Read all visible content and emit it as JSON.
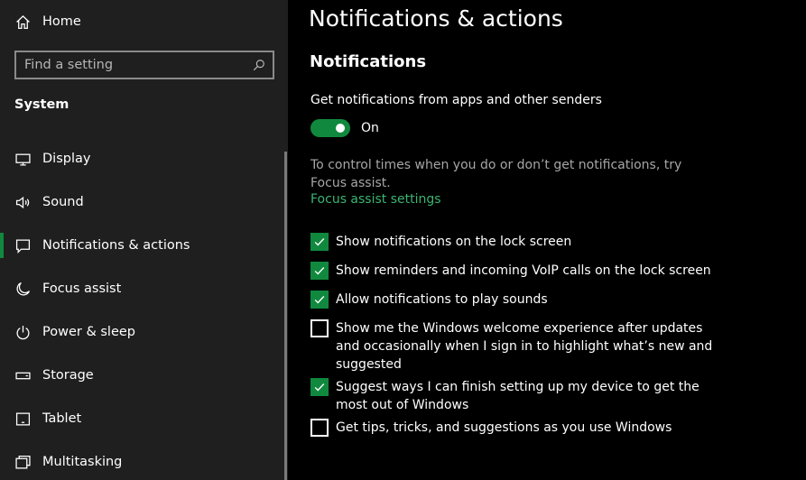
{
  "colors": {
    "accent": "#10893e",
    "link": "#3cb371",
    "sidebar_bg": "#1f1f1f",
    "main_bg": "#000000"
  },
  "sidebar": {
    "home": {
      "label": "Home",
      "icon": "home-icon"
    },
    "search": {
      "placeholder": "Find a setting",
      "value": "",
      "icon": "search-icon"
    },
    "section": "System",
    "items": [
      {
        "label": "Display",
        "icon": "display-icon",
        "active": false
      },
      {
        "label": "Sound",
        "icon": "speaker-icon",
        "active": false
      },
      {
        "label": "Notifications & actions",
        "icon": "notification-icon",
        "active": true
      },
      {
        "label": "Focus assist",
        "icon": "moon-icon",
        "active": false
      },
      {
        "label": "Power & sleep",
        "icon": "power-icon",
        "active": false
      },
      {
        "label": "Storage",
        "icon": "storage-icon",
        "active": false
      },
      {
        "label": "Tablet",
        "icon": "tablet-icon",
        "active": false
      },
      {
        "label": "Multitasking",
        "icon": "multitasking-icon",
        "active": false
      }
    ]
  },
  "main": {
    "title": "Notifications & actions",
    "subtitle": "Notifications",
    "get_notifications_label": "Get notifications from apps and other senders",
    "toggle": {
      "on": true,
      "state_label": "On"
    },
    "focus_description": "To control times when you do or don’t get notifications, try Focus assist.",
    "focus_link": "Focus assist settings",
    "checkboxes": [
      {
        "label": "Show notifications on the lock screen",
        "checked": true
      },
      {
        "label": "Show reminders and incoming VoIP calls on the lock screen",
        "checked": true
      },
      {
        "label": "Allow notifications to play sounds",
        "checked": true
      },
      {
        "label": "Show me the Windows welcome experience after updates and occasionally when I sign in to highlight what’s new and suggested",
        "checked": false
      },
      {
        "label": "Suggest ways I can finish setting up my device to get the most out of Windows",
        "checked": true
      },
      {
        "label": "Get tips, tricks, and suggestions as you use Windows",
        "checked": false
      }
    ]
  }
}
